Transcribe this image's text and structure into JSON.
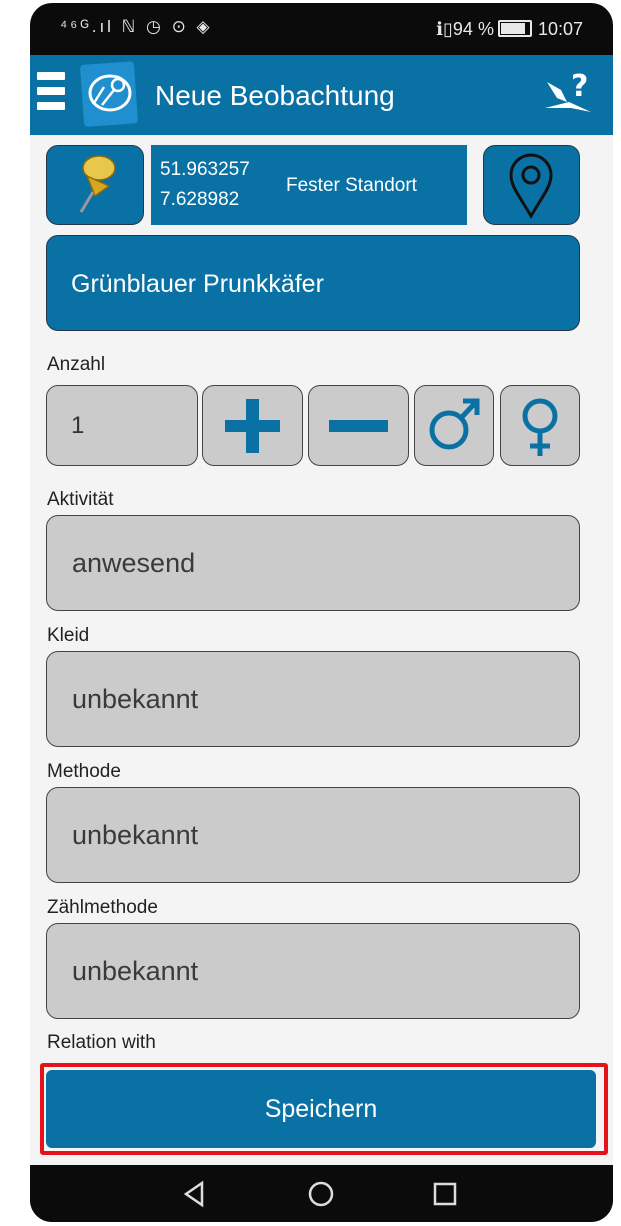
{
  "status_bar": {
    "left_icons": "⁴⁶ᴳ.ıl ℕ ◷ ⊙ ◈",
    "battery_percent": "94 %",
    "time": "10:07",
    "vibrate_icon": "vibrate-icon"
  },
  "app_bar": {
    "title": "Neue Beobachtung",
    "menu_icon": "hamburger-menu-icon",
    "logo_icon": "app-logo-icon",
    "help_icon": "help-icon"
  },
  "location": {
    "latitude": "51.963257",
    "longitude": "7.628982",
    "mode": "Fester Standort",
    "pin_icon": "pushpin-icon",
    "marker_icon": "map-marker-icon"
  },
  "species": {
    "name": "Grünblauer Prunkkäfer"
  },
  "count": {
    "label": "Anzahl",
    "value": "1",
    "plus_icon": "plus-icon",
    "minus_icon": "minus-icon",
    "male_icon": "male-symbol-icon",
    "female_icon": "female-symbol-icon"
  },
  "activity": {
    "label": "Aktivität",
    "value": "anwesend"
  },
  "dress": {
    "label": "Kleid",
    "value": "unbekannt"
  },
  "method": {
    "label": "Methode",
    "value": "unbekannt"
  },
  "count_method": {
    "label": "Zählmethode",
    "value": "unbekannt"
  },
  "relation": {
    "label": "Relation with"
  },
  "save_label": "Speichern",
  "nav": {
    "back": "back-icon",
    "home": "home-icon",
    "recents": "recents-icon"
  },
  "colors": {
    "primary": "#0a71a4",
    "field_bg": "#cbcbcb",
    "highlight": "#e4121b"
  }
}
